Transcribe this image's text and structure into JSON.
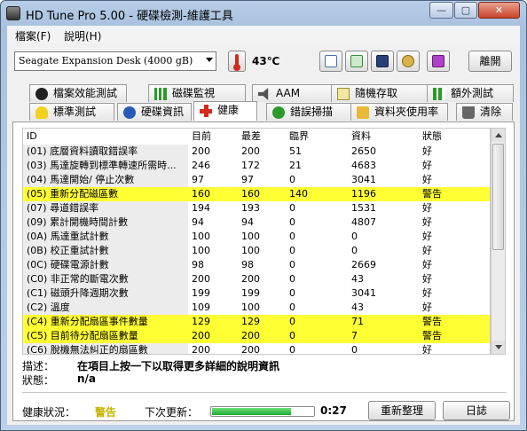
{
  "window": {
    "title": "HD Tune Pro  5.00 - 硬碟檢測-維護工具",
    "min": "—",
    "max": "▢",
    "close": "✕"
  },
  "menu": [
    "檔案(F)",
    "說明(H)"
  ],
  "toolbar": {
    "drive": "Seagate Expansion Desk  (4000 gB)",
    "temperature": "43℃",
    "exit_label": "離開"
  },
  "tabs_top": [
    "檔案效能測試",
    "磁碟監視",
    "AAM",
    "隨機存取",
    "額外測試"
  ],
  "tabs_bottom": [
    "標準測試",
    "硬碟資訊",
    "健康",
    "錯誤掃描",
    "資料夾使用率",
    "清除"
  ],
  "active_tab": "健康",
  "grid": {
    "headers": [
      "ID",
      "目前",
      "最差",
      "臨界",
      "資料",
      "狀態"
    ],
    "rows": [
      {
        "id": "(01) 底層資料讀取錯誤率",
        "current": "200",
        "worst": "200",
        "threshold": "51",
        "data": "2650",
        "status": "好",
        "warn": false
      },
      {
        "id": "(03) 馬達旋轉到標準轉速所需時...",
        "current": "246",
        "worst": "172",
        "threshold": "21",
        "data": "4683",
        "status": "好",
        "warn": false
      },
      {
        "id": "(04) 馬達開始/ 停止次數",
        "current": "97",
        "worst": "97",
        "threshold": "0",
        "data": "3041",
        "status": "好",
        "warn": false
      },
      {
        "id": "(05) 重新分配磁區數",
        "current": "160",
        "worst": "160",
        "threshold": "140",
        "data": "1196",
        "status": "警告",
        "warn": true
      },
      {
        "id": "(07) 尋道錯誤率",
        "current": "194",
        "worst": "193",
        "threshold": "0",
        "data": "1531",
        "status": "好",
        "warn": false
      },
      {
        "id": "(09) 累計開機時間計數",
        "current": "94",
        "worst": "94",
        "threshold": "0",
        "data": "4807",
        "status": "好",
        "warn": false
      },
      {
        "id": "(0A) 馬達重試計數",
        "current": "100",
        "worst": "100",
        "threshold": "0",
        "data": "0",
        "status": "好",
        "warn": false
      },
      {
        "id": "(0B) 校正重試計數",
        "current": "100",
        "worst": "100",
        "threshold": "0",
        "data": "0",
        "status": "好",
        "warn": false
      },
      {
        "id": "(0C) 硬碟電源計數",
        "current": "98",
        "worst": "98",
        "threshold": "0",
        "data": "2669",
        "status": "好",
        "warn": false
      },
      {
        "id": "(C0) 非正常的斷電次數",
        "current": "200",
        "worst": "200",
        "threshold": "0",
        "data": "43",
        "status": "好",
        "warn": false
      },
      {
        "id": "(C1) 磁頭升降週期次數",
        "current": "199",
        "worst": "199",
        "threshold": "0",
        "data": "3041",
        "status": "好",
        "warn": false
      },
      {
        "id": "(C2) 溫度",
        "current": "109",
        "worst": "100",
        "threshold": "0",
        "data": "43",
        "status": "好",
        "warn": false
      },
      {
        "id": "(C4) 重新分配扇區事件數量",
        "current": "129",
        "worst": "129",
        "threshold": "0",
        "data": "71",
        "status": "警告",
        "warn": true
      },
      {
        "id": "(C5) 目前待分配扇區數量",
        "current": "200",
        "worst": "200",
        "threshold": "0",
        "data": "7",
        "status": "警告",
        "warn": true
      },
      {
        "id": "(C6) 脫機無法糾正的扇區數",
        "current": "200",
        "worst": "200",
        "threshold": "0",
        "data": "0",
        "status": "好",
        "warn": false
      }
    ]
  },
  "details": {
    "desc_label": "描述：",
    "desc_value": "在項目上按一下以取得更多詳細的說明資訊",
    "status_label": "狀態：",
    "status_value": "n/a"
  },
  "footer": {
    "health_label": "健康狀況：",
    "health_value": "警告",
    "next_update_label": "下次更新：",
    "countdown": "0:27",
    "progress_fraction": 0.78,
    "refresh_label": "重新整理",
    "log_label": "日誌"
  },
  "colors": {
    "warn": "#ffff33",
    "health": "#c8b400",
    "progress": "#1ea832"
  }
}
